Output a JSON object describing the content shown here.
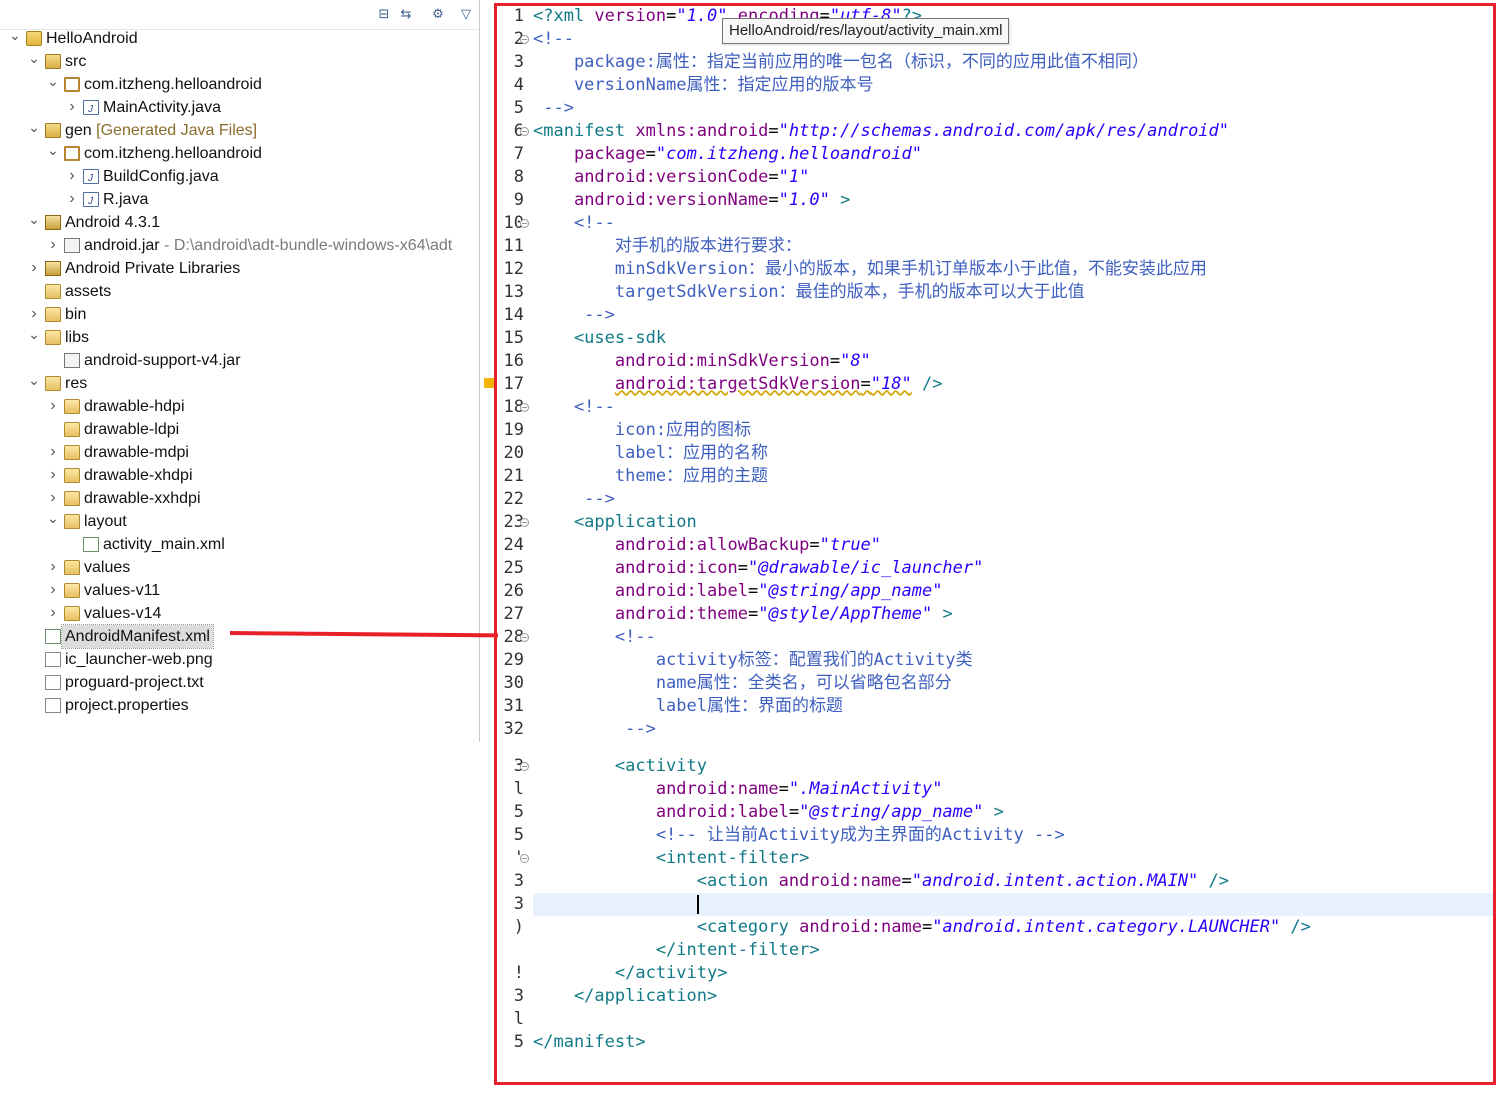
{
  "tooltip": "HelloAndroid/res/layout/activity_main.xml",
  "explorer": {
    "toolbar": [
      {
        "name": "collapse-all-icon",
        "glyph": "⊟"
      },
      {
        "name": "link-with-editor-icon",
        "glyph": "⇆"
      },
      {
        "name": "view-menu-gear-icon",
        "glyph": "⚙"
      },
      {
        "name": "view-menu-chevron-icon",
        "glyph": "▽"
      }
    ],
    "tree": [
      {
        "depth": 0,
        "arrow": "open",
        "icon": "project",
        "label": "HelloAndroid",
        "suffix": ""
      },
      {
        "depth": 1,
        "arrow": "open",
        "icon": "srcfolder",
        "label": "src",
        "suffix": ""
      },
      {
        "depth": 2,
        "arrow": "open",
        "icon": "package",
        "label": "com.itzheng.helloandroid",
        "suffix": ""
      },
      {
        "depth": 3,
        "arrow": "closed",
        "icon": "java",
        "label": "MainActivity.java",
        "suffix": ""
      },
      {
        "depth": 1,
        "arrow": "open",
        "icon": "srcfolder",
        "label": "gen",
        "suffix": " [Generated Java Files]"
      },
      {
        "depth": 2,
        "arrow": "open",
        "icon": "package",
        "label": "com.itzheng.helloandroid",
        "suffix": ""
      },
      {
        "depth": 3,
        "arrow": "closed",
        "icon": "java",
        "label": "BuildConfig.java",
        "suffix": ""
      },
      {
        "depth": 3,
        "arrow": "closed",
        "icon": "java",
        "label": "R.java",
        "suffix": ""
      },
      {
        "depth": 1,
        "arrow": "open",
        "icon": "lib",
        "label": "Android 4.3.1",
        "suffix": ""
      },
      {
        "depth": 2,
        "arrow": "closed",
        "icon": "jar",
        "label": "android.jar",
        "suffix": " - D:\\android\\adt-bundle-windows-x64\\adt"
      },
      {
        "depth": 1,
        "arrow": "closed",
        "icon": "lib",
        "label": "Android Private Libraries",
        "suffix": ""
      },
      {
        "depth": 1,
        "arrow": "none",
        "icon": "folder",
        "label": "assets",
        "suffix": ""
      },
      {
        "depth": 1,
        "arrow": "closed",
        "icon": "folder",
        "label": "bin",
        "suffix": ""
      },
      {
        "depth": 1,
        "arrow": "open",
        "icon": "folder",
        "label": "libs",
        "suffix": ""
      },
      {
        "depth": 2,
        "arrow": "none",
        "icon": "jar",
        "label": "android-support-v4.jar",
        "suffix": ""
      },
      {
        "depth": 1,
        "arrow": "open",
        "icon": "folder",
        "label": "res",
        "suffix": ""
      },
      {
        "depth": 2,
        "arrow": "closed",
        "icon": "folder",
        "label": "drawable-hdpi",
        "suffix": ""
      },
      {
        "depth": 2,
        "arrow": "none",
        "icon": "folder",
        "label": "drawable-ldpi",
        "suffix": ""
      },
      {
        "depth": 2,
        "arrow": "closed",
        "icon": "folder",
        "label": "drawable-mdpi",
        "suffix": ""
      },
      {
        "depth": 2,
        "arrow": "closed",
        "icon": "folder",
        "label": "drawable-xhdpi",
        "suffix": ""
      },
      {
        "depth": 2,
        "arrow": "closed",
        "icon": "folder",
        "label": "drawable-xxhdpi",
        "suffix": ""
      },
      {
        "depth": 2,
        "arrow": "open",
        "icon": "folder",
        "label": "layout",
        "suffix": ""
      },
      {
        "depth": 3,
        "arrow": "none",
        "icon": "xml",
        "label": "activity_main.xml",
        "suffix": ""
      },
      {
        "depth": 2,
        "arrow": "closed",
        "icon": "folder",
        "label": "values",
        "suffix": ""
      },
      {
        "depth": 2,
        "arrow": "closed",
        "icon": "folder",
        "label": "values-v11",
        "suffix": ""
      },
      {
        "depth": 2,
        "arrow": "closed",
        "icon": "folder",
        "label": "values-v14",
        "suffix": ""
      },
      {
        "depth": 1,
        "arrow": "none",
        "icon": "xml",
        "label": "AndroidManifest.xml",
        "suffix": "",
        "selected": true
      },
      {
        "depth": 1,
        "arrow": "none",
        "icon": "file",
        "label": "ic_launcher-web.png",
        "suffix": ""
      },
      {
        "depth": 1,
        "arrow": "none",
        "icon": "file",
        "label": "proguard-project.txt",
        "suffix": ""
      },
      {
        "depth": 1,
        "arrow": "none",
        "icon": "file",
        "label": "project.properties",
        "suffix": ""
      }
    ]
  },
  "editor": {
    "lines": [
      {
        "n": "1",
        "fold": false,
        "parts": [
          [
            "pi",
            "<?xml "
          ],
          [
            "attr",
            "version"
          ],
          [
            "",
            "="
          ],
          [
            "str",
            "\"1.0\""
          ],
          [
            "",
            " "
          ],
          [
            "attr",
            "encoding"
          ],
          [
            "",
            "="
          ],
          [
            "str",
            "\"utf-8\""
          ],
          [
            "pi",
            "?>"
          ]
        ]
      },
      {
        "n": "2",
        "fold": true,
        "parts": [
          [
            "comment",
            "<!--"
          ]
        ]
      },
      {
        "n": "3",
        "fold": false,
        "parts": [
          [
            "comment",
            "    package:属性：指定当前应用的唯一包名（标识，不同的应用此值不相同）"
          ]
        ]
      },
      {
        "n": "4",
        "fold": false,
        "parts": [
          [
            "comment",
            "    versionName属性：指定应用的版本号"
          ]
        ]
      },
      {
        "n": "5",
        "fold": false,
        "parts": [
          [
            "comment",
            " -->"
          ]
        ]
      },
      {
        "n": "6",
        "fold": true,
        "parts": [
          [
            "tag",
            "<manifest "
          ],
          [
            "attr",
            "xmlns:android"
          ],
          [
            "",
            "="
          ],
          [
            "str",
            "\"http://schemas.android.com/apk/res/android\""
          ]
        ]
      },
      {
        "n": "7",
        "fold": false,
        "parts": [
          [
            "",
            "    "
          ],
          [
            "attr",
            "package"
          ],
          [
            "",
            "="
          ],
          [
            "str",
            "\"com.itzheng.helloandroid\""
          ]
        ]
      },
      {
        "n": "8",
        "fold": false,
        "parts": [
          [
            "",
            "    "
          ],
          [
            "attr",
            "android:versionCode"
          ],
          [
            "",
            "="
          ],
          [
            "str",
            "\"1\""
          ]
        ]
      },
      {
        "n": "9",
        "fold": false,
        "parts": [
          [
            "",
            "    "
          ],
          [
            "attr",
            "android:versionName"
          ],
          [
            "",
            "="
          ],
          [
            "str",
            "\"1.0\""
          ],
          [
            "tag",
            " >"
          ]
        ]
      },
      {
        "n": "10",
        "fold": true,
        "parts": [
          [
            "comment",
            "    <!--"
          ]
        ]
      },
      {
        "n": "11",
        "fold": false,
        "parts": [
          [
            "comment",
            "        对手机的版本进行要求："
          ]
        ]
      },
      {
        "n": "12",
        "fold": false,
        "parts": [
          [
            "comment",
            "        minSdkVersion：最小的版本，如果手机订单版本小于此值，不能安装此应用"
          ]
        ]
      },
      {
        "n": "13",
        "fold": false,
        "parts": [
          [
            "comment",
            "        targetSdkVersion：最佳的版本，手机的版本可以大于此值"
          ]
        ]
      },
      {
        "n": "14",
        "fold": false,
        "parts": [
          [
            "comment",
            "     -->"
          ]
        ]
      },
      {
        "n": "15",
        "fold": false,
        "parts": [
          [
            "tag",
            "    <uses-sdk"
          ]
        ]
      },
      {
        "n": "16",
        "fold": false,
        "parts": [
          [
            "",
            "        "
          ],
          [
            "attr",
            "android:minSdkVersion"
          ],
          [
            "",
            "="
          ],
          [
            "str",
            "\"8\""
          ]
        ]
      },
      {
        "n": "17",
        "fold": false,
        "warn": true,
        "parts": [
          [
            "",
            "        "
          ],
          [
            "attr squiggle",
            "android:targetSdkVersion"
          ],
          [
            "squiggle",
            "="
          ],
          [
            "str squiggle",
            "\"18\""
          ],
          [
            "tag",
            " />"
          ]
        ]
      },
      {
        "n": "18",
        "fold": true,
        "parts": [
          [
            "comment",
            "    <!--"
          ]
        ]
      },
      {
        "n": "19",
        "fold": false,
        "parts": [
          [
            "comment",
            "        icon:应用的图标"
          ]
        ]
      },
      {
        "n": "20",
        "fold": false,
        "parts": [
          [
            "comment",
            "        label：应用的名称"
          ]
        ]
      },
      {
        "n": "21",
        "fold": false,
        "parts": [
          [
            "comment",
            "        theme：应用的主题"
          ]
        ]
      },
      {
        "n": "22",
        "fold": false,
        "parts": [
          [
            "comment",
            "     -->"
          ]
        ]
      },
      {
        "n": "23",
        "fold": true,
        "parts": [
          [
            "tag",
            "    <application"
          ]
        ]
      },
      {
        "n": "24",
        "fold": false,
        "parts": [
          [
            "",
            "        "
          ],
          [
            "attr",
            "android:allowBackup"
          ],
          [
            "",
            "="
          ],
          [
            "str",
            "\"true\""
          ]
        ]
      },
      {
        "n": "25",
        "fold": false,
        "parts": [
          [
            "",
            "        "
          ],
          [
            "attr",
            "android:icon"
          ],
          [
            "",
            "="
          ],
          [
            "str",
            "\"@drawable/ic_launcher\""
          ]
        ]
      },
      {
        "n": "26",
        "fold": false,
        "parts": [
          [
            "",
            "        "
          ],
          [
            "attr",
            "android:label"
          ],
          [
            "",
            "="
          ],
          [
            "str",
            "\"@string/app_name\""
          ]
        ]
      },
      {
        "n": "27",
        "fold": false,
        "parts": [
          [
            "",
            "        "
          ],
          [
            "attr",
            "android:theme"
          ],
          [
            "",
            "="
          ],
          [
            "str",
            "\"@style/AppTheme\""
          ],
          [
            "tag",
            " >"
          ]
        ]
      },
      {
        "n": "28",
        "fold": true,
        "parts": [
          [
            "comment",
            "        <!--"
          ]
        ]
      },
      {
        "n": "29",
        "fold": false,
        "parts": [
          [
            "comment",
            "            activity标签：配置我们的Activity类"
          ]
        ]
      },
      {
        "n": "30",
        "fold": false,
        "parts": [
          [
            "comment",
            "            name属性：全类名，可以省略包名部分"
          ]
        ]
      },
      {
        "n": "31",
        "fold": false,
        "parts": [
          [
            "comment",
            "            label属性：界面的标题"
          ]
        ]
      },
      {
        "n": "32",
        "fold": false,
        "parts": [
          [
            "comment",
            "         -->"
          ]
        ]
      },
      {
        "n": "3",
        "fold": true,
        "gap": true,
        "parts": [
          [
            "tag",
            "        <activity"
          ]
        ]
      },
      {
        "n": "l",
        "fold": false,
        "parts": [
          [
            "",
            "            "
          ],
          [
            "attr",
            "android:name"
          ],
          [
            "",
            "="
          ],
          [
            "str",
            "\".MainActivity\""
          ]
        ]
      },
      {
        "n": "5",
        "fold": false,
        "parts": [
          [
            "",
            "            "
          ],
          [
            "attr",
            "android:label"
          ],
          [
            "",
            "="
          ],
          [
            "str",
            "\"@string/app_name\""
          ],
          [
            "tag",
            " >"
          ]
        ]
      },
      {
        "n": "5",
        "fold": false,
        "parts": [
          [
            "comment",
            "            <!-- 让当前Activity成为主界面的Activity -->"
          ]
        ]
      },
      {
        "n": "'",
        "fold": true,
        "parts": [
          [
            "tag",
            "            <intent-filter>"
          ]
        ]
      },
      {
        "n": "3",
        "fold": false,
        "parts": [
          [
            "tag",
            "                <action "
          ],
          [
            "attr",
            "android:name"
          ],
          [
            "",
            "="
          ],
          [
            "str",
            "\"android.intent.action.MAIN\""
          ],
          [
            "tag",
            " />"
          ]
        ]
      },
      {
        "n": "3",
        "fold": false,
        "current": true,
        "parts": [
          [
            "",
            "                "
          ],
          [
            "caret",
            ""
          ]
        ]
      },
      {
        "n": ")",
        "fold": false,
        "parts": [
          [
            "tag",
            "                <category "
          ],
          [
            "attr",
            "android:name"
          ],
          [
            "",
            "="
          ],
          [
            "str",
            "\"android.intent.category.LAUNCHER\""
          ],
          [
            "tag",
            " />"
          ]
        ]
      },
      {
        "n": "",
        "fold": false,
        "parts": [
          [
            "tag",
            "            </intent-filter>"
          ]
        ]
      },
      {
        "n": "!",
        "fold": false,
        "parts": [
          [
            "tag",
            "        </activity>"
          ]
        ]
      },
      {
        "n": "3",
        "fold": false,
        "parts": [
          [
            "tag",
            "    </application>"
          ]
        ]
      },
      {
        "n": "l",
        "fold": false,
        "parts": [
          [
            "",
            ""
          ]
        ]
      },
      {
        "n": "5",
        "fold": false,
        "parts": [
          [
            "tag",
            "</manifest>"
          ]
        ]
      }
    ]
  },
  "annotation": {
    "frame_color": "#e8202a"
  }
}
